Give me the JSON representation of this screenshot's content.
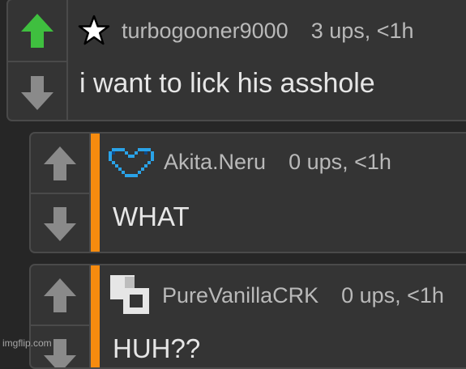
{
  "comments": [
    {
      "avatar": "star-icon",
      "username": "turbogooner9000",
      "meta": "3 ups, <1h",
      "text": "i want to lick his asshole",
      "upvoted": true
    },
    {
      "avatar": "pixel-heart-icon",
      "username": "Akita.Neru",
      "meta": "0 ups, <1h",
      "text": "WHAT",
      "upvoted": false
    },
    {
      "avatar": "overlapping-squares-icon",
      "username": "PureVanillaCRK",
      "meta": "0 ups, <1h",
      "text": "HUH??",
      "upvoted": false
    }
  ],
  "watermark": "imgflip.com",
  "colors": {
    "upvote_active": "#3fbf3f",
    "vote_inactive": "#8a8a8a",
    "reply_accent": "#f68b0f",
    "background": "#262626",
    "card": "#343434"
  }
}
